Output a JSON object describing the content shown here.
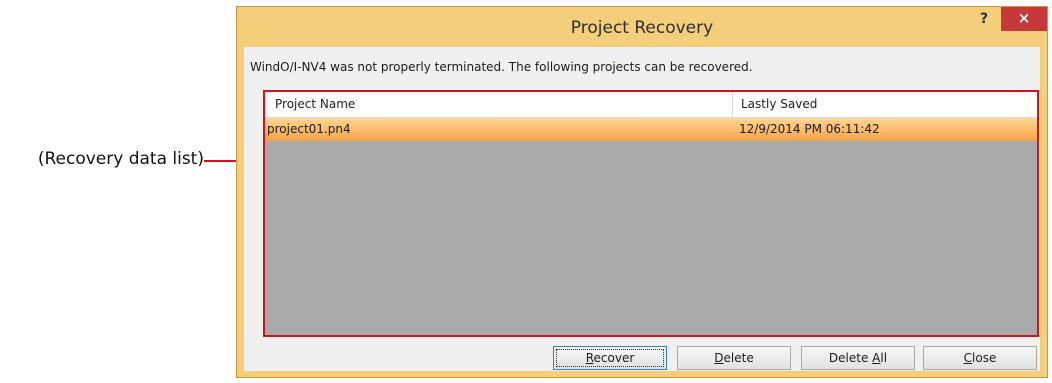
{
  "callout": {
    "label": "(Recovery data list)"
  },
  "window": {
    "title": "Project Recovery",
    "help_label": "?",
    "close_label": "×"
  },
  "message": "WindO/I-NV4 was not properly terminated. The following projects can be recovered.",
  "list": {
    "columns": [
      "Project Name",
      "Lastly Saved"
    ],
    "rows": [
      {
        "name": "project01.pn4",
        "saved": "12/9/2014 PM 06:11:42",
        "selected": true
      }
    ]
  },
  "buttons": {
    "recover": {
      "mnemonic": "R",
      "rest": "ecover"
    },
    "delete": {
      "mnemonic": "D",
      "rest": "elete"
    },
    "delete_all": {
      "prefix": "Delete ",
      "mnemonic": "A",
      "rest": "ll"
    },
    "close": {
      "mnemonic": "C",
      "rest": "lose"
    }
  },
  "colors": {
    "callout": "#d4121c",
    "frame": "#f4ce7b",
    "selection": "#f5a54a",
    "close_button": "#c7383a"
  }
}
